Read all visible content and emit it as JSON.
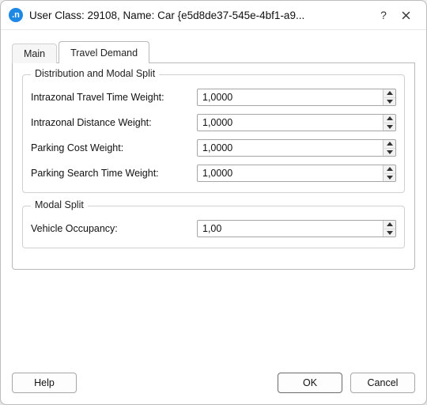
{
  "title": "User Class: 29108, Name: Car  {e5d8de37-545e-4bf1-a9...",
  "app_icon_glyph": ".n",
  "tabs": {
    "main": {
      "label": "Main"
    },
    "travel": {
      "label": "Travel Demand"
    }
  },
  "group_distribution": {
    "title": "Distribution and Modal Split",
    "intrazonal_travel_time_weight_label": "Intrazonal Travel Time Weight:",
    "intrazonal_travel_time_weight_value": "1,0000",
    "intrazonal_distance_weight_label": "Intrazonal Distance Weight:",
    "intrazonal_distance_weight_value": "1,0000",
    "parking_cost_weight_label": "Parking Cost Weight:",
    "parking_cost_weight_value": "1,0000",
    "parking_search_time_weight_label": "Parking Search Time Weight:",
    "parking_search_time_weight_value": "1,0000"
  },
  "group_modal_split": {
    "title": "Modal Split",
    "vehicle_occupancy_label": "Vehicle Occupancy:",
    "vehicle_occupancy_value": "1,00"
  },
  "buttons": {
    "help": "Help",
    "ok": "OK",
    "cancel": "Cancel"
  },
  "titlebar_icons": {
    "help_glyph": "?"
  }
}
